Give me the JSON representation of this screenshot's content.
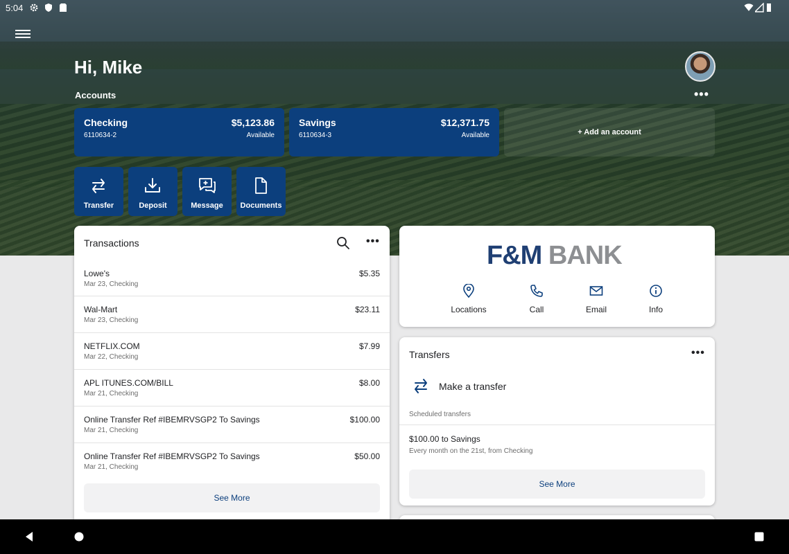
{
  "status_bar": {
    "time": "5:04"
  },
  "header": {
    "greeting": "Hi, Mike",
    "accounts_label": "Accounts"
  },
  "accounts": [
    {
      "name": "Checking",
      "number": "6110634-2",
      "balance": "$5,123.86",
      "balance_label": "Available"
    },
    {
      "name": "Savings",
      "number": "6110634-3",
      "balance": "$12,371.75",
      "balance_label": "Available"
    }
  ],
  "add_account_label": "+ Add an account",
  "quick_actions": [
    {
      "label": "Transfer"
    },
    {
      "label": "Deposit"
    },
    {
      "label": "Message"
    },
    {
      "label": "Documents"
    }
  ],
  "transactions": {
    "title": "Transactions",
    "items": [
      {
        "description": "Lowe's",
        "amount": "$5.35",
        "subtitle": "Mar 23, Checking"
      },
      {
        "description": "Wal-Mart",
        "amount": "$23.11",
        "subtitle": "Mar 23, Checking"
      },
      {
        "description": "NETFLIX.COM",
        "amount": "$7.99",
        "subtitle": "Mar 22, Checking"
      },
      {
        "description": "APL ITUNES.COM/BILL",
        "amount": "$8.00",
        "subtitle": "Mar 21, Checking"
      },
      {
        "description": "Online Transfer Ref #IBEMRVSGP2 To Savings",
        "amount": "$100.00",
        "subtitle": "Mar 21, Checking"
      },
      {
        "description": "Online Transfer Ref #IBEMRVSGP2 To Savings",
        "amount": "$50.00",
        "subtitle": "Mar 21, Checking"
      }
    ],
    "see_more": "See More"
  },
  "bank": {
    "logo_left": "F&M",
    "logo_right": "BANK",
    "actions": [
      {
        "label": "Locations",
        "icon": "map-pin-icon"
      },
      {
        "label": "Call",
        "icon": "phone-icon"
      },
      {
        "label": "Email",
        "icon": "mail-icon"
      },
      {
        "label": "Info",
        "icon": "info-icon"
      }
    ]
  },
  "transfers": {
    "title": "Transfers",
    "make_transfer": "Make a transfer",
    "scheduled_label": "Scheduled transfers",
    "scheduled_item": {
      "title": "$100.00 to Savings",
      "subtitle": "Every month on the 21st, from Checking"
    },
    "see_more": "See More"
  },
  "colors": {
    "brand_navy": "#0c3f7d",
    "logo_gray": "#8d8f92"
  }
}
